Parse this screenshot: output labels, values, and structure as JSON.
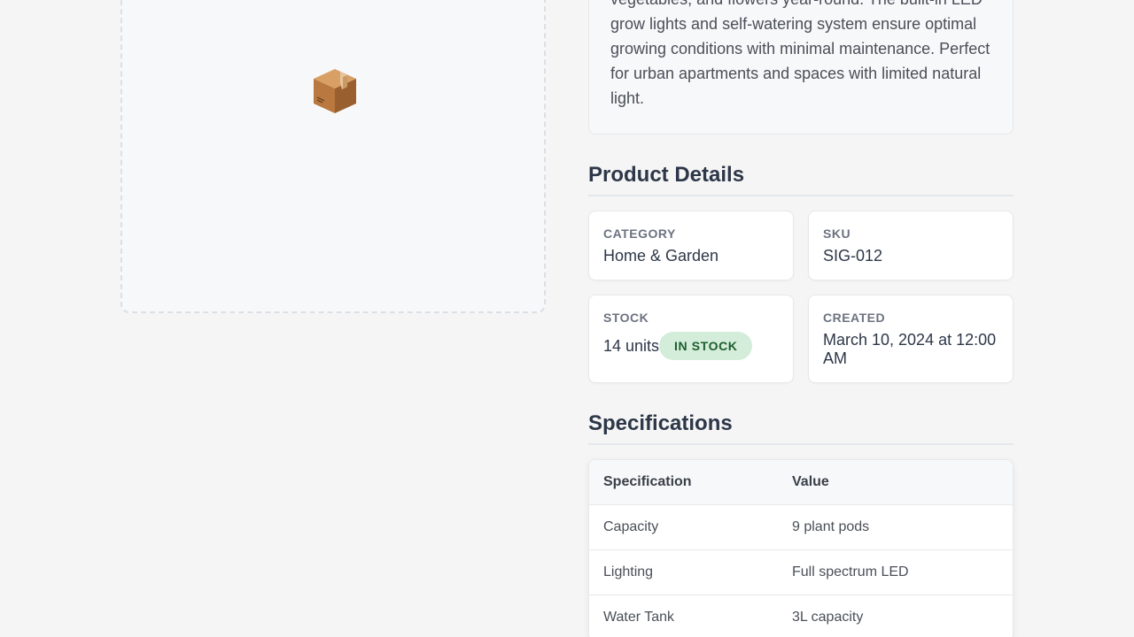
{
  "product": {
    "image_icon": "package-icon",
    "description": "vegetables, and flowers year-round. The built-in LED grow lights and self-watering system ensure optimal growing conditions with minimal maintenance. Perfect for urban apartments and spaces with limited natural light."
  },
  "details": {
    "title": "Product Details",
    "category_label": "CATEGORY",
    "category_value": "Home & Garden",
    "sku_label": "SKU",
    "sku_value": "SIG-012",
    "stock_label": "STOCK",
    "stock_value": "14 units",
    "stock_badge": "IN STOCK",
    "created_label": "CREATED",
    "created_value": "March 10, 2024 at 12:00 AM"
  },
  "specs": {
    "title": "Specifications",
    "headers": [
      "Specification",
      "Value"
    ],
    "rows": [
      {
        "name": "Capacity",
        "value": "9 plant pods"
      },
      {
        "name": "Lighting",
        "value": "Full spectrum LED"
      },
      {
        "name": "Water Tank",
        "value": "3L capacity"
      }
    ]
  },
  "colors": {
    "badge_bg": "#d4edda",
    "badge_text": "#1e5d2d",
    "heading": "#2d3748"
  }
}
